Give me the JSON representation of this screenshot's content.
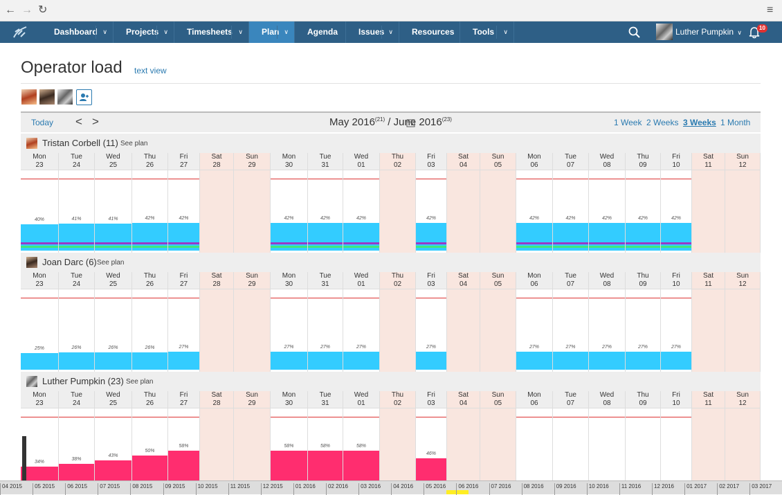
{
  "browser": {
    "back": "←",
    "forward": "→",
    "reload": "↻",
    "menu": "≡"
  },
  "nav": {
    "items": [
      {
        "label": "Dashboard",
        "caret": "∨"
      },
      {
        "label": "Projects",
        "caret": "∨"
      },
      {
        "label": "Timesheets",
        "caret": "∨"
      },
      {
        "label": "Plan",
        "caret": "∨"
      },
      {
        "label": "Agenda",
        "caret": ""
      },
      {
        "label": "Issues",
        "caret": "∨"
      },
      {
        "label": "Resources",
        "caret": ""
      },
      {
        "label": "Tools",
        "caret": "∨"
      }
    ],
    "user": "Luther Pumpkin",
    "user_caret": "∨",
    "notif_count": "10"
  },
  "page": {
    "title": "Operator load",
    "text_view": "text view"
  },
  "toolbar": {
    "today": "Today",
    "prev": "<",
    "next": ">",
    "month1": "May 2016",
    "count1": "(21)",
    "sep": " / ",
    "month2": "June 2016",
    "count2": "(23)",
    "ranges": [
      "1 Week",
      "2 Weeks",
      "3 Weeks",
      "1 Month"
    ]
  },
  "days": [
    {
      "d": "Mon",
      "n": "23",
      "we": false
    },
    {
      "d": "Tue",
      "n": "24",
      "we": false
    },
    {
      "d": "Wed",
      "n": "25",
      "we": false
    },
    {
      "d": "Thu",
      "n": "26",
      "we": false
    },
    {
      "d": "Fri",
      "n": "27",
      "we": false
    },
    {
      "d": "Sat",
      "n": "28",
      "we": true
    },
    {
      "d": "Sun",
      "n": "29",
      "we": true
    },
    {
      "d": "Mon",
      "n": "30",
      "we": false
    },
    {
      "d": "Tue",
      "n": "31",
      "we": false
    },
    {
      "d": "Wed",
      "n": "01",
      "we": false
    },
    {
      "d": "Thu",
      "n": "02",
      "we": true
    },
    {
      "d": "Fri",
      "n": "03",
      "we": false
    },
    {
      "d": "Sat",
      "n": "04",
      "we": true
    },
    {
      "d": "Sun",
      "n": "05",
      "we": true
    },
    {
      "d": "Mon",
      "n": "06",
      "we": false
    },
    {
      "d": "Tue",
      "n": "07",
      "we": false
    },
    {
      "d": "Wed",
      "n": "08",
      "we": false
    },
    {
      "d": "Thu",
      "n": "09",
      "we": false
    },
    {
      "d": "Fri",
      "n": "10",
      "we": false
    },
    {
      "d": "Sat",
      "n": "11",
      "we": true
    },
    {
      "d": "Sun",
      "n": "12",
      "we": true
    }
  ],
  "operators": [
    {
      "name": "Tristan Corbell (11)",
      "see_plan": "See plan",
      "load": [
        {
          "p": "40%",
          "v": 40
        },
        {
          "p": "41%",
          "v": 41
        },
        {
          "p": "41%",
          "v": 41
        },
        {
          "p": "42%",
          "v": 42
        },
        {
          "p": "42%",
          "v": 42
        },
        null,
        null,
        {
          "p": "42%",
          "v": 42
        },
        {
          "p": "42%",
          "v": 42
        },
        {
          "p": "42%",
          "v": 42
        },
        null,
        {
          "p": "42%",
          "v": 42
        },
        null,
        null,
        {
          "p": "42%",
          "v": 42
        },
        {
          "p": "42%",
          "v": 42
        },
        {
          "p": "42%",
          "v": 42
        },
        {
          "p": "42%",
          "v": 42
        },
        {
          "p": "42%",
          "v": 42
        },
        null,
        null
      ],
      "colors": [
        "#33ccff",
        "#9a39c6",
        "#3ee87d"
      ]
    },
    {
      "name": "Joan Darc (6)",
      "see_plan": "See plan",
      "load": [
        {
          "p": "25%",
          "v": 25
        },
        {
          "p": "26%",
          "v": 26
        },
        {
          "p": "26%",
          "v": 26
        },
        {
          "p": "26%",
          "v": 26
        },
        {
          "p": "27%",
          "v": 27
        },
        null,
        null,
        {
          "p": "27%",
          "v": 27
        },
        {
          "p": "27%",
          "v": 27
        },
        {
          "p": "27%",
          "v": 27
        },
        null,
        {
          "p": "27%",
          "v": 27
        },
        null,
        null,
        {
          "p": "27%",
          "v": 27
        },
        {
          "p": "27%",
          "v": 27
        },
        {
          "p": "27%",
          "v": 27
        },
        {
          "p": "27%",
          "v": 27
        },
        {
          "p": "27%",
          "v": 27
        },
        null,
        null
      ],
      "colors": [
        "#33ccff"
      ]
    },
    {
      "name": "Luther Pumpkin (23)",
      "see_plan": "See plan",
      "load": [
        {
          "p": "34%",
          "v": 34
        },
        {
          "p": "38%",
          "v": 38
        },
        {
          "p": "43%",
          "v": 43
        },
        {
          "p": "50%",
          "v": 50
        },
        {
          "p": "58%",
          "v": 58
        },
        null,
        null,
        {
          "p": "58%",
          "v": 58
        },
        {
          "p": "58%",
          "v": 58
        },
        {
          "p": "58%",
          "v": 58
        },
        null,
        {
          "p": "46%",
          "v": 46
        },
        null,
        null,
        null,
        null,
        null,
        null,
        null,
        null,
        null
      ],
      "colors": [
        "#ff2d6f",
        "#ffee22"
      ]
    }
  ],
  "timeline": [
    "04 2015",
    "05 2015",
    "06 2015",
    "07 2015",
    "08 2015",
    "09 2015",
    "10 2015",
    "11 2015",
    "12 2015",
    "01 2016",
    "02 2016",
    "03 2016",
    "04 2016",
    "05 2016",
    "06 2016",
    "07 2016",
    "08 2016",
    "09 2016",
    "10 2016",
    "11 2016",
    "12 2016",
    "01 2017",
    "02 2017",
    "03 2017"
  ]
}
